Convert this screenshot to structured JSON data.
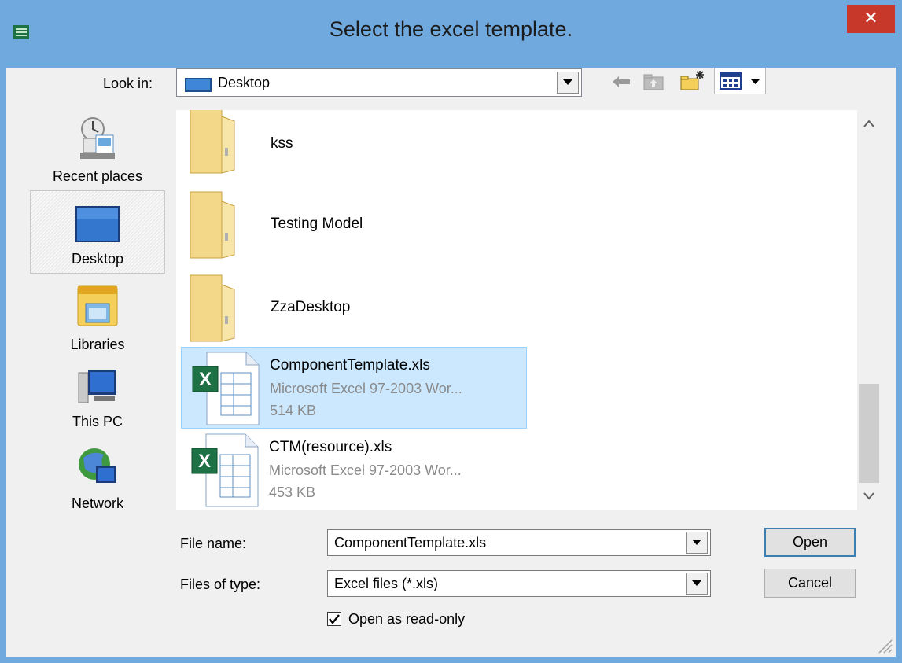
{
  "window": {
    "title": "Select the excel template.",
    "close_label": "✕"
  },
  "toolbar": {
    "look_in_label": "Look in:",
    "look_in_value": "Desktop",
    "icons": [
      "back-arrow-icon",
      "up-folder-icon",
      "new-folder-icon",
      "view-menu-icon"
    ]
  },
  "places": [
    {
      "label": "Recent places",
      "icon": "recent-places-icon",
      "selected": false
    },
    {
      "label": "Desktop",
      "icon": "desktop-icon",
      "selected": true
    },
    {
      "label": "Libraries",
      "icon": "libraries-icon",
      "selected": false
    },
    {
      "label": "This PC",
      "icon": "this-pc-icon",
      "selected": false
    },
    {
      "label": "Network",
      "icon": "network-icon",
      "selected": false
    }
  ],
  "files": [
    {
      "name": "kss",
      "kind": "folder"
    },
    {
      "name": "Testing Model",
      "kind": "folder"
    },
    {
      "name": "ZzaDesktop",
      "kind": "folder"
    },
    {
      "name": "ComponentTemplate.xls",
      "type": "Microsoft Excel 97-2003 Wor...",
      "size": "514 KB",
      "kind": "excel",
      "selected": true
    },
    {
      "name": "CTM(resource).xls",
      "type": "Microsoft Excel 97-2003 Wor...",
      "size": "453 KB",
      "kind": "excel",
      "selected": false
    }
  ],
  "form": {
    "file_name_label": "File name:",
    "file_name_value": "ComponentTemplate.xls",
    "file_type_label": "Files of type:",
    "file_type_value": "Excel files (*.xls)",
    "read_only_label": "Open as read-only",
    "read_only_checked": true,
    "open_label": "Open",
    "cancel_label": "Cancel"
  },
  "colors": {
    "title_bar": "#6fa9de",
    "close_button": "#c7382b",
    "selection": "#cce8ff"
  }
}
